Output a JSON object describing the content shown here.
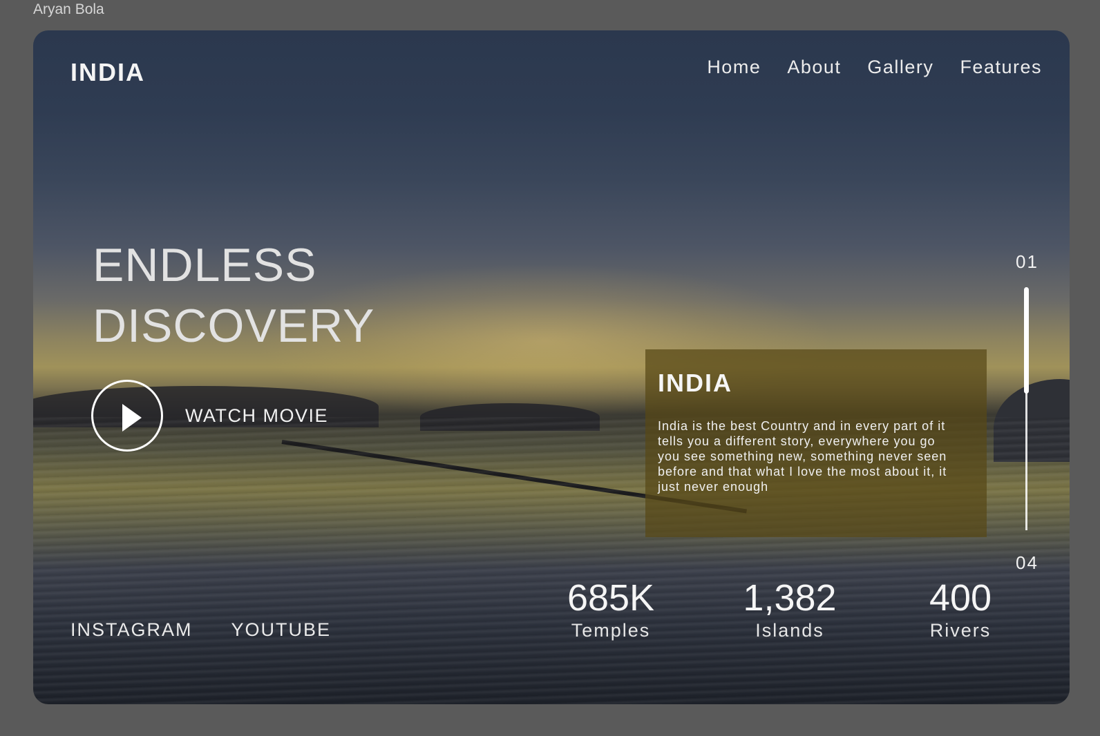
{
  "author": "Aryan Bola",
  "header": {
    "brand": "INDIA",
    "nav": [
      "Home",
      "About",
      "Gallery",
      "Features"
    ]
  },
  "hero": {
    "title_line1": "ENDLESS",
    "title_line2": "DISCOVERY",
    "watch_label": "WATCH MOVIE"
  },
  "card": {
    "title": "INDIA",
    "body": "India is the best Country and in every part of it tells you a different story, everywhere you go you see something new, something never seen before and that what I love the most about it, it just never enough"
  },
  "slider": {
    "start": "01",
    "end": "04",
    "progress": 0.25
  },
  "socials": [
    "INSTAGRAM",
    "YOUTUBE"
  ],
  "stats": [
    {
      "value": "685K",
      "label": "Temples"
    },
    {
      "value": "1,382",
      "label": "Islands"
    },
    {
      "value": "400",
      "label": "Rivers"
    }
  ],
  "colors": {
    "page_bg": "#5a5a5a",
    "card_bg": "#58481a"
  }
}
